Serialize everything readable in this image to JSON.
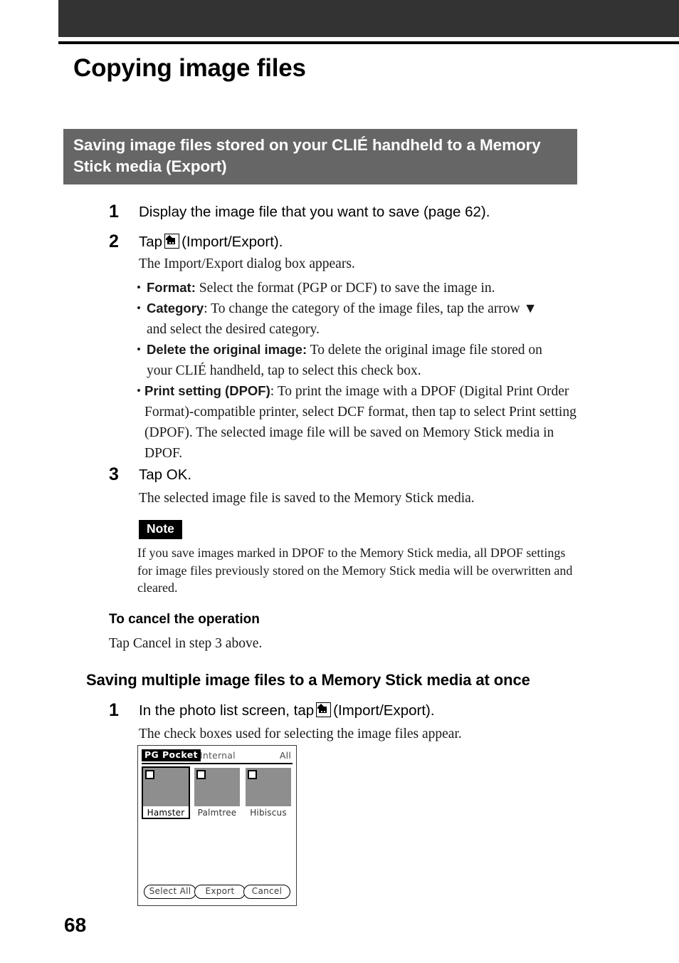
{
  "page": {
    "number": "68",
    "chapter_title": "Copying image files"
  },
  "section": {
    "band_title": "Saving image files stored on your CLIÉ handheld to a Memory Stick media (Export)",
    "band_bg": "#666666",
    "band_fg": "#ffffff"
  },
  "steps": [
    {
      "num": "1",
      "title": "Display the image file that you want to save (page 62)."
    },
    {
      "num": "2",
      "title_prefix": "Tap",
      "icon": "import-export-icon",
      "title_suffix": "(Import/Export).",
      "sub": "The Import/Export dialog box appears.",
      "bullets": [
        {
          "label": "Format:",
          "text": " Select the format (PGP or DCF) to save the image in."
        },
        {
          "label": "Category",
          "text": ": To change the category of the image files, tap the arrow ▼ and select the desired category."
        },
        {
          "label": "Delete the original image:",
          "text": " To delete the original image file stored on your CLIÉ handheld, tap to select this check box."
        },
        {
          "label": "Print setting (DPOF)",
          "text": ": To print the image with a DPOF (Digital Print Order Format)-compatible printer, select DCF format, then tap to select Print setting (DPOF). The selected image file will be saved on Memory Stick media in DPOF."
        }
      ]
    },
    {
      "num": "3",
      "title": "Tap OK.",
      "sub": "The selected image file is saved to the Memory Stick media."
    }
  ],
  "note": {
    "badge": "Note",
    "body": "If you save images marked in DPOF to the Memory Stick media, all DPOF settings for image files previously stored on the Memory Stick media will be overwritten and cleared."
  },
  "cancel_section": {
    "heading": "To cancel the operation",
    "body": "Tap Cancel in step 3 above."
  },
  "multi_section": {
    "heading": "Saving multiple image files to a Memory Stick media at once",
    "step_num": "1",
    "step_prefix": "In the photo list screen, tap",
    "step_icon": "import-export-icon",
    "step_suffix": "(Import/Export).",
    "step_sub": "The check boxes used for selecting the image files appear."
  },
  "pda_screen": {
    "app_name": "PG Pocket",
    "source_label": "Internal",
    "category_label": "All",
    "thumbnails": [
      {
        "caption": "Hamster",
        "checked": false,
        "selected": true
      },
      {
        "caption": "Palmtree",
        "checked": false,
        "selected": false
      },
      {
        "caption": "Hibiscus",
        "checked": false,
        "selected": false
      }
    ],
    "buttons": [
      {
        "label": "Select All"
      },
      {
        "label": "Export"
      },
      {
        "label": "Cancel"
      }
    ]
  }
}
